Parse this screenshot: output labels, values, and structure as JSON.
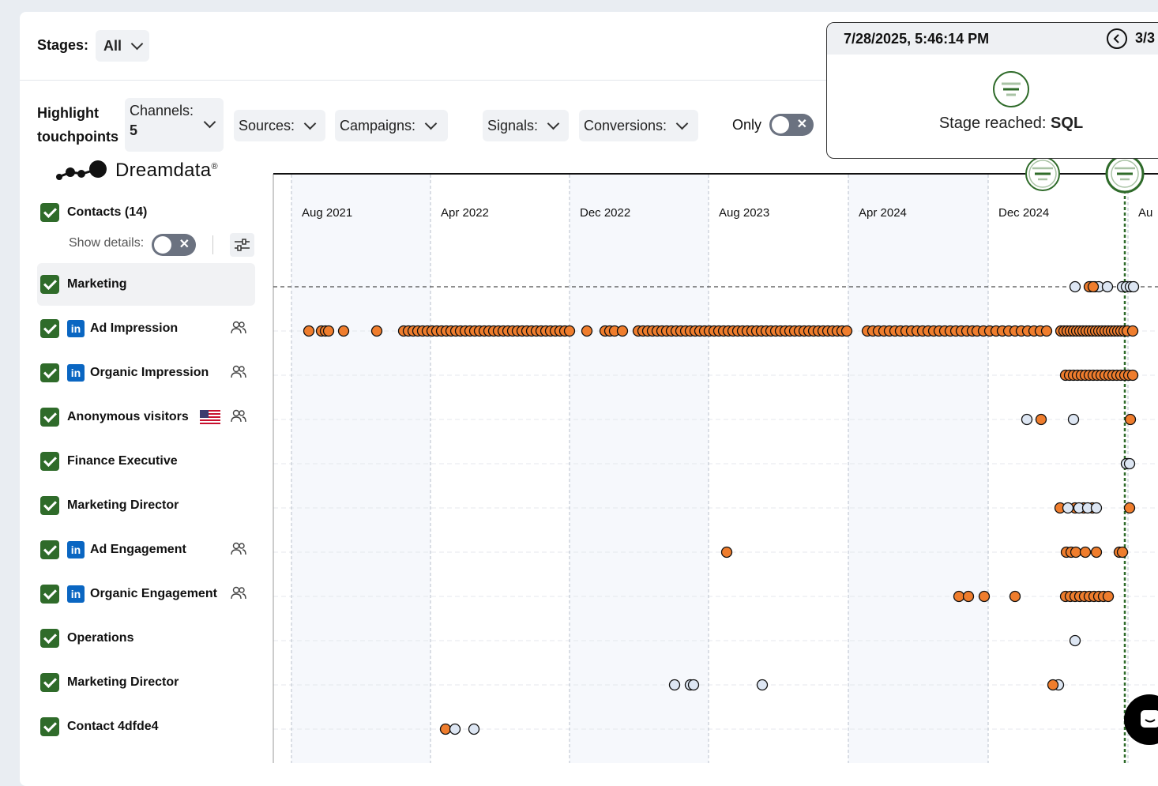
{
  "stages": {
    "label": "Stages:",
    "value": "All"
  },
  "highlight": {
    "label_line1": "Highlight",
    "label_line2": "touchpoints",
    "channels": {
      "label": "Channels:",
      "value": "5"
    },
    "sources": "Sources:",
    "campaigns": "Campaigns:",
    "signals": "Signals:",
    "conversions": "Conversions:",
    "only_label": "Only"
  },
  "logo": {
    "text": "Dreamdata",
    "mark": "®"
  },
  "contacts": {
    "label": "Contacts (14)",
    "show_details": "Show details:"
  },
  "rows": [
    {
      "label": "Marketing",
      "linkedin": false,
      "people": false,
      "flag": false
    },
    {
      "label": "Ad Impression",
      "linkedin": true,
      "people": true,
      "flag": false
    },
    {
      "label": "Organic Impression",
      "linkedin": true,
      "people": true,
      "flag": false
    },
    {
      "label": "Anonymous visitors",
      "linkedin": false,
      "people": true,
      "flag": true
    },
    {
      "label": "Finance Executive",
      "linkedin": false,
      "people": false,
      "flag": false
    },
    {
      "label": "Marketing Director",
      "linkedin": false,
      "people": false,
      "flag": false
    },
    {
      "label": "Ad Engagement",
      "linkedin": true,
      "people": true,
      "flag": false
    },
    {
      "label": "Organic Engagement",
      "linkedin": true,
      "people": true,
      "flag": false
    },
    {
      "label": "Operations",
      "linkedin": false,
      "people": false,
      "flag": false
    },
    {
      "label": "Marketing Director",
      "linkedin": false,
      "people": false,
      "flag": false
    },
    {
      "label": "Contact 4dfde4",
      "linkedin": false,
      "people": false,
      "flag": false
    }
  ],
  "timeline": {
    "months": [
      "Aug 2021",
      "Apr 2022",
      "Dec 2022",
      "Aug 2023",
      "Apr 2024",
      "Dec 2024",
      "Au"
    ]
  },
  "popup": {
    "timestamp": "7/28/2025, 5:46:14 PM",
    "pager": "3/3",
    "stage_label": "Stage reached:",
    "stage_value": "SQL"
  },
  "colors": {
    "accent_green": "#2f6b2a",
    "touch_orange": "#ef7d2d",
    "touch_light": "#dde6f3",
    "linkedin": "#0a66c2"
  }
}
